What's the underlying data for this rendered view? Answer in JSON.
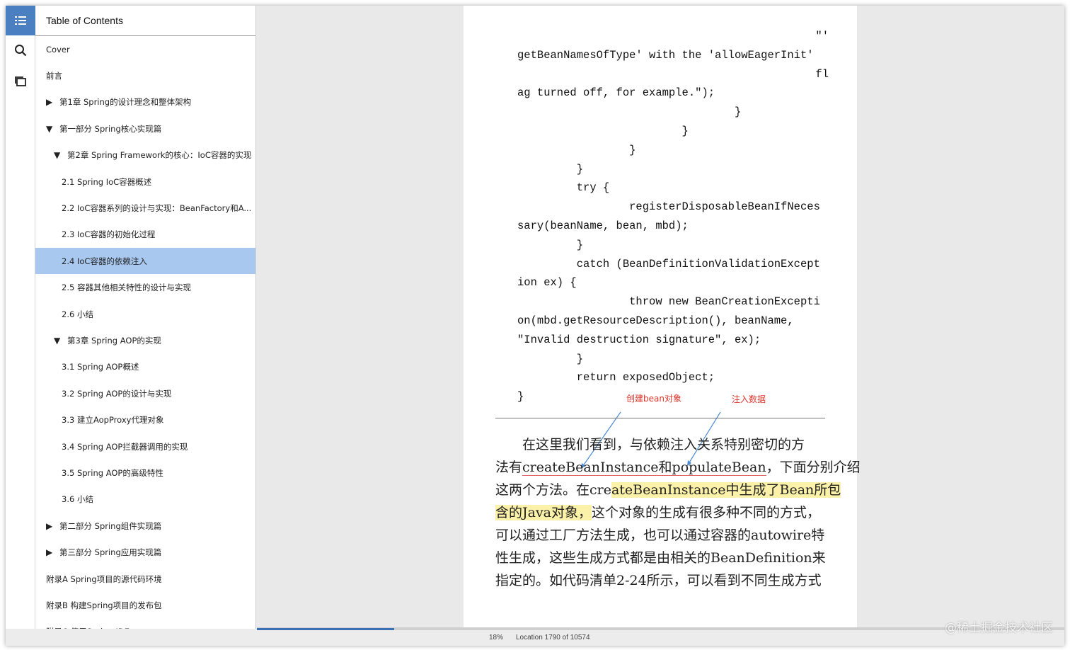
{
  "rail": {
    "toc_icon": "list-icon",
    "search_icon": "search-icon",
    "flashcards_icon": "cards-icon"
  },
  "toc": {
    "title": "Table of Contents",
    "items": [
      {
        "label": "Cover",
        "level": 0,
        "arrow": ""
      },
      {
        "label": "前言",
        "level": 0,
        "arrow": ""
      },
      {
        "label": "第1章 Spring的设计理念和整体架构",
        "level": 0,
        "arrow": "▶"
      },
      {
        "label": "第一部分 Spring核心实现篇",
        "level": 0,
        "arrow": "▼"
      },
      {
        "label": "第2章 Spring Framework的核心：IoC容器的实现",
        "level": 1,
        "arrow": "▼"
      },
      {
        "label": "2.1 Spring IoC容器概述",
        "level": 2,
        "arrow": ""
      },
      {
        "label": "2.2 IoC容器系列的设计与实现：BeanFactory和A...",
        "level": 2,
        "arrow": ""
      },
      {
        "label": "2.3 IoC容器的初始化过程",
        "level": 2,
        "arrow": ""
      },
      {
        "label": "2.4 IoC容器的依赖注入",
        "level": 2,
        "arrow": "",
        "selected": true
      },
      {
        "label": "2.5 容器其他相关特性的设计与实现",
        "level": 2,
        "arrow": ""
      },
      {
        "label": "2.6 小结",
        "level": 2,
        "arrow": ""
      },
      {
        "label": "第3章 Spring AOP的实现",
        "level": 1,
        "arrow": "▼"
      },
      {
        "label": "3.1 Spring AOP概述",
        "level": 2,
        "arrow": ""
      },
      {
        "label": "3.2 Spring AOP的设计与实现",
        "level": 2,
        "arrow": ""
      },
      {
        "label": "3.3 建立AopProxy代理对象",
        "level": 2,
        "arrow": ""
      },
      {
        "label": "3.4 Spring AOP拦截器调用的实现",
        "level": 2,
        "arrow": ""
      },
      {
        "label": "3.5 Spring AOP的高级特性",
        "level": 2,
        "arrow": ""
      },
      {
        "label": "3.6 小结",
        "level": 2,
        "arrow": ""
      },
      {
        "label": "第二部分 Spring组件实现篇",
        "level": 0,
        "arrow": "▶"
      },
      {
        "label": "第三部分 Spring应用实现篇",
        "level": 0,
        "arrow": "▶"
      },
      {
        "label": "附录A Spring项目的源代码环境",
        "level": 0,
        "arrow": ""
      },
      {
        "label": "附录B 构建Spring项目的发布包",
        "level": 0,
        "arrow": ""
      },
      {
        "label": "附录C 使用Spring IDE",
        "level": 0,
        "arrow": ""
      }
    ]
  },
  "page": {
    "code_lines": [
      {
        "text": "\"'",
        "align": "right"
      },
      {
        "text": "getBeanNamesOfType' with the 'allowEagerInit'",
        "align": "left"
      },
      {
        "text": "fl",
        "align": "right"
      },
      {
        "text": "ag turned off, for example.\");",
        "align": "left"
      },
      {
        "text": "                                 }",
        "align": "left"
      },
      {
        "text": "                         }",
        "align": "left"
      },
      {
        "text": "                 }",
        "align": "left"
      },
      {
        "text": "         }",
        "align": "left"
      },
      {
        "text": "         try {",
        "align": "left"
      },
      {
        "text": "                 registerDisposableBeanIfNeces",
        "align": "left"
      },
      {
        "text": "sary(beanName, bean, mbd);",
        "align": "left"
      },
      {
        "text": "         }",
        "align": "left"
      },
      {
        "text": "         catch (BeanDefinitionValidationExcept",
        "align": "left"
      },
      {
        "text": "ion ex) {",
        "align": "left"
      },
      {
        "text": "                 throw new BeanCreationExcepti",
        "align": "left"
      },
      {
        "text": "on(mbd.getResourceDescription(), beanName,",
        "align": "left"
      },
      {
        "text": "\"Invalid destruction signature\", ex);",
        "align": "left"
      },
      {
        "text": "         }",
        "align": "left"
      },
      {
        "text": "         return exposedObject;",
        "align": "left"
      },
      {
        "text": "}",
        "align": "left"
      }
    ],
    "annotation_1": "创建bean对象",
    "annotation_2": "注入数据",
    "paragraph": {
      "l1": "　　在这里我们看到，与依赖注入关系特别密切的方",
      "l2a": "法有",
      "l2b": "createBeanInstance和populateBean",
      "l2c": "，下面分别介绍",
      "l3a": "这两个方法。在cre",
      "l3b": "ateBeanInstance中生成了Bean所包",
      "l4a": "含的Java对象，",
      "l4b": "这个对象的生成有很多种不同的方式，",
      "l5": "可以通过工厂方法生成，也可以通过容器的autowire特",
      "l6": "性生成，这些生成方式都是由相关的BeanDefinition来",
      "l7": "指定的。如代码清单2-24所示，可以看到不同生成方式"
    }
  },
  "status": {
    "percent": "18%",
    "location": "Location 1790 of 10574",
    "progress": 0.17
  },
  "watermark": "@稀土掘金技术社区",
  "colors": {
    "rail_active": "#4a7fc1",
    "toc_selected": "#a8c8f0",
    "annotation": "#e0352b",
    "highlight": "#fbf1a8",
    "progress": "#3b6fb6"
  }
}
